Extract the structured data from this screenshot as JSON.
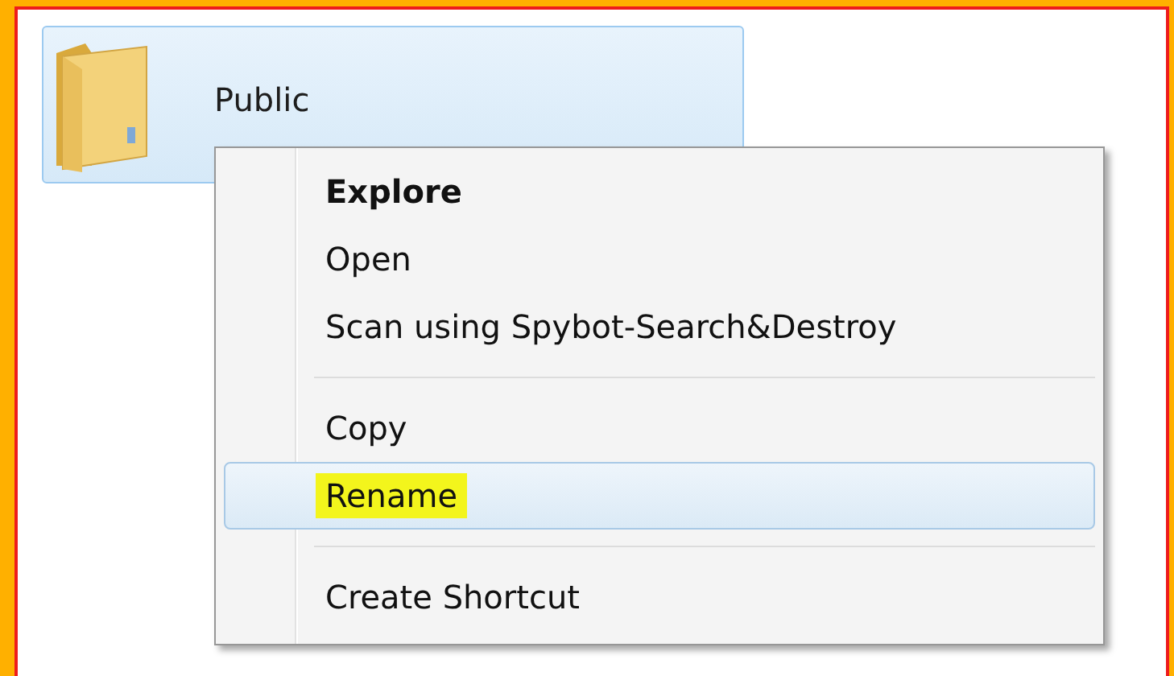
{
  "folder": {
    "name": "Public",
    "selected": true
  },
  "menu": {
    "items": [
      {
        "kind": "item",
        "label": "Explore",
        "bold": true,
        "hovered": false,
        "highlighted": false
      },
      {
        "kind": "item",
        "label": "Open",
        "bold": false,
        "hovered": false,
        "highlighted": false
      },
      {
        "kind": "item",
        "label": "Scan using Spybot-Search&Destroy",
        "bold": false,
        "hovered": false,
        "highlighted": false
      },
      {
        "kind": "separator"
      },
      {
        "kind": "item",
        "label": "Copy",
        "bold": false,
        "hovered": false,
        "highlighted": false
      },
      {
        "kind": "item",
        "label": "Rename",
        "bold": false,
        "hovered": true,
        "highlighted": true
      },
      {
        "kind": "separator"
      },
      {
        "kind": "item",
        "label": "Create Shortcut",
        "bold": false,
        "hovered": false,
        "highlighted": false
      }
    ]
  }
}
